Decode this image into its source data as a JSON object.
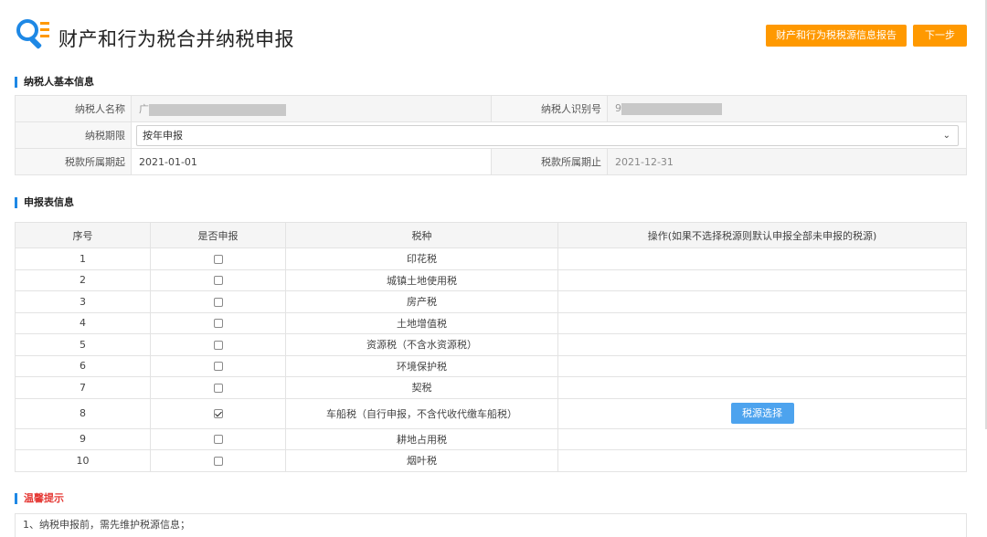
{
  "header": {
    "title": "财产和行为税合并纳税申报",
    "report_button": "财产和行为税税源信息报告",
    "next_button": "下一步"
  },
  "taxpayer_section": {
    "title": "纳税人基本信息",
    "name_label": "纳税人名称",
    "name_value": "广",
    "id_label": "纳税人识别号",
    "id_value": "9",
    "period_label": "纳税期限",
    "period_value": "按年申报",
    "start_label": "税款所属期起",
    "start_value": "2021-01-01",
    "end_label": "税款所属期止",
    "end_value": "2021-12-31"
  },
  "declaration_section": {
    "title": "申报表信息",
    "columns": [
      "序号",
      "是否申报",
      "税种",
      "操作(如果不选择税源则默认申报全部未申报的税源)"
    ],
    "action_button": "税源选择",
    "rows": [
      {
        "no": "1",
        "checked": false,
        "tax": "印花税"
      },
      {
        "no": "2",
        "checked": false,
        "tax": "城镇土地使用税"
      },
      {
        "no": "3",
        "checked": false,
        "tax": "房产税"
      },
      {
        "no": "4",
        "checked": false,
        "tax": "土地增值税"
      },
      {
        "no": "5",
        "checked": false,
        "tax": "资源税（不含水资源税）"
      },
      {
        "no": "6",
        "checked": false,
        "tax": "环境保护税"
      },
      {
        "no": "7",
        "checked": false,
        "tax": "契税"
      },
      {
        "no": "8",
        "checked": true,
        "tax": "车船税（自行申报，不含代收代缴车船税）"
      },
      {
        "no": "9",
        "checked": false,
        "tax": "耕地占用税"
      },
      {
        "no": "10",
        "checked": false,
        "tax": "烟叶税"
      }
    ]
  },
  "tips_section": {
    "title": "温馨提示",
    "tip_1": "1、纳税申报前，需先维护税源信息；"
  },
  "colors": {
    "accent_orange": "#ff9900",
    "accent_blue": "#4da3ee",
    "section_bar": "#1e88e5",
    "warning_red": "#e53935"
  }
}
